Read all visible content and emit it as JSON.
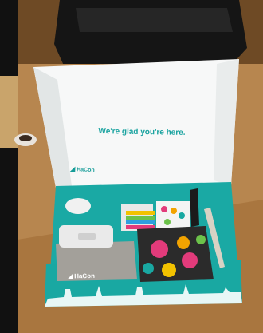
{
  "scene": {
    "lid_tagline": "We're glad you're here.",
    "lid_brand": "HaCon",
    "box_front_brand": "HaCon",
    "logo_icon": "hacon-logo-icon"
  }
}
